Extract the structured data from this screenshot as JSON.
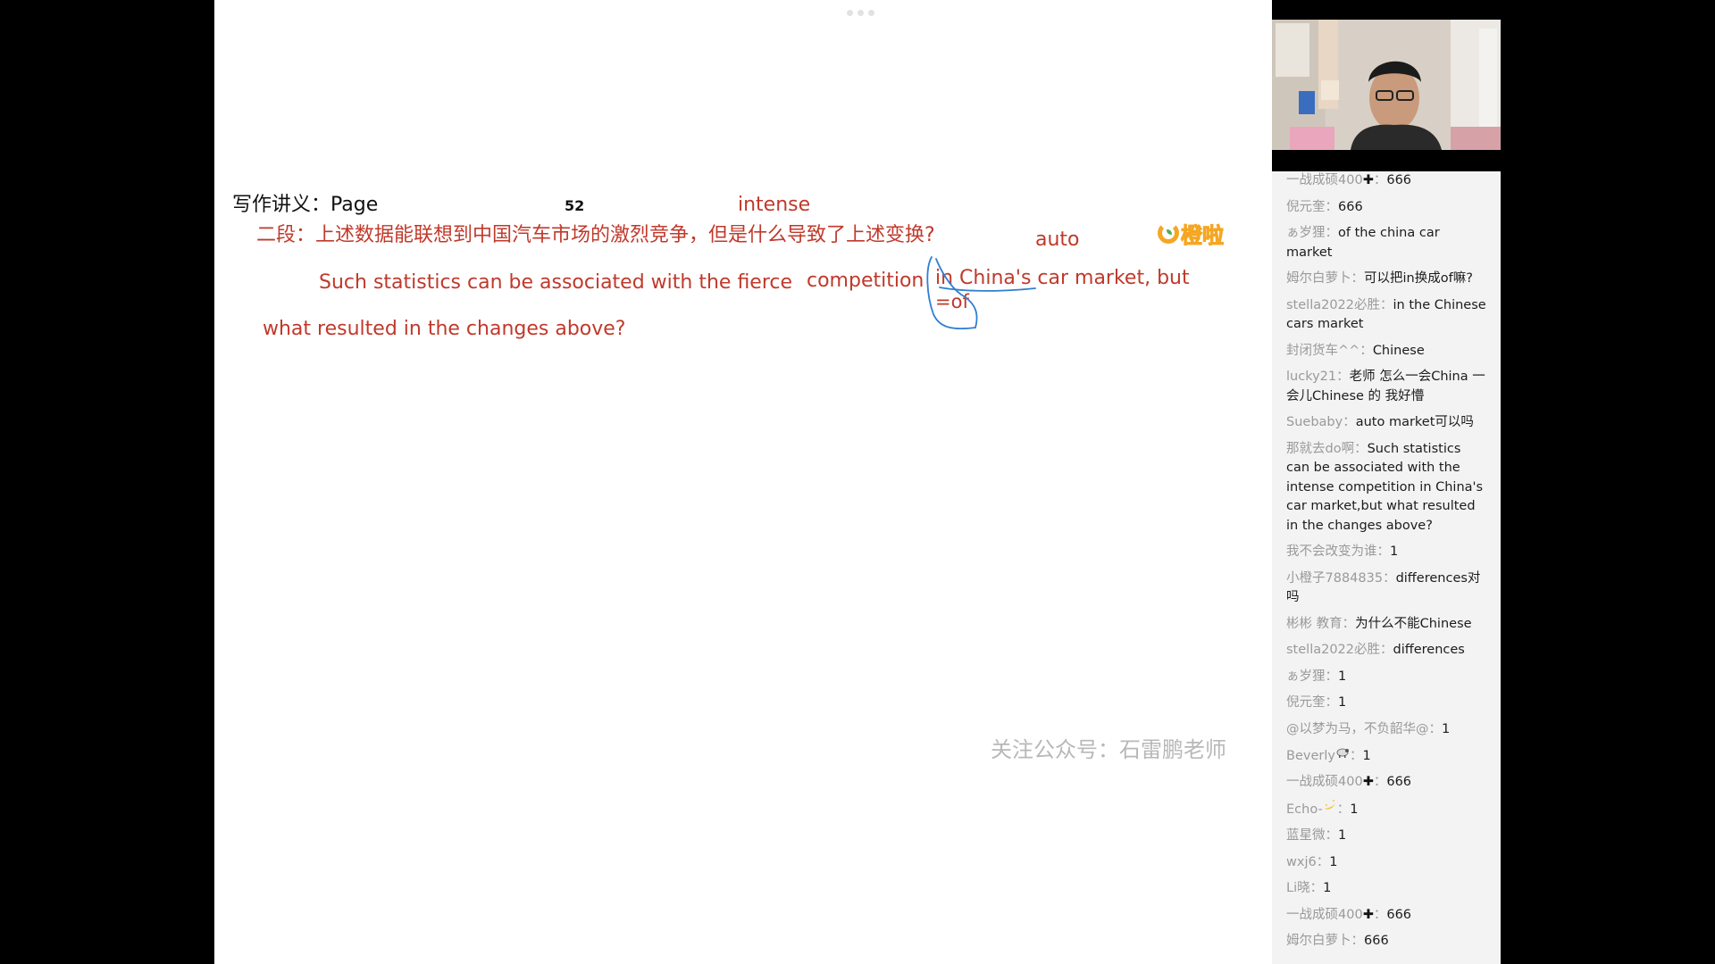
{
  "board": {
    "heading": "写作讲义：Page",
    "page_number": "52",
    "line1": "二段：上述数据能联想到中国汽车市场的激烈竞争，但是什么导致了上述变换?",
    "ann_intense": "intense",
    "ann_auto": "auto",
    "line2_a": "Such statistics can be associated with the fierce",
    "line2_b": "competition",
    "line2_c": "in China's car market, but",
    "ann_of": "=of",
    "line3": "what resulted in the changes above?",
    "logo_text": "橙啦",
    "watermark": "关注公众号：石雷鹏老师"
  },
  "chat": [
    {
      "user": "一战成硕400",
      "cross": true,
      "text": "666"
    },
    {
      "user": "倪元奎",
      "text": "666"
    },
    {
      "user": "ぁ岁狸",
      "text": "of the china car market"
    },
    {
      "user": "姆尔白萝卜",
      "text": "可以把in换成of嘛?"
    },
    {
      "user": "stella2022必胜",
      "text": "in the Chinese cars market"
    },
    {
      "user": "封闭货车^^",
      "text": "Chinese"
    },
    {
      "user": "lucky21",
      "text": "老师 怎么一会China 一会儿Chinese 的  我好懵"
    },
    {
      "user": "Suebaby",
      "text": "auto market可以吗"
    },
    {
      "user": "那就去do啊",
      "text": "Such statistics can be associated with the intense competition in China's car market,but what resulted in the changes above?"
    },
    {
      "user": "我不会改变为谁",
      "text": "1"
    },
    {
      "user": "小橙子7884835",
      "text": "differences对吗"
    },
    {
      "user": "彬彬 教育",
      "text": "为什么不能Chinese"
    },
    {
      "user": "stella2022必胜",
      "text": "differences"
    },
    {
      "user": "ぁ岁狸",
      "text": "1"
    },
    {
      "user": "倪元奎",
      "text": "1"
    },
    {
      "user": "@以梦为马，不负韶华@",
      "text": "1"
    },
    {
      "user": "Beverly",
      "emoji": "sheep",
      "text": "1"
    },
    {
      "user": "一战成硕400",
      "cross": true,
      "text": "666"
    },
    {
      "user": "Echo-",
      "emoji": "moon",
      "text": "1"
    },
    {
      "user": "蓝星微",
      "text": "1"
    },
    {
      "user": "wxj6",
      "text": "1"
    },
    {
      "user": "Li晓",
      "text": "1"
    },
    {
      "user": "一战成硕400",
      "cross": true,
      "text": "666"
    },
    {
      "user": "姆尔白萝卜",
      "text": "666"
    }
  ],
  "colors": {
    "handwriting": "#c0392b",
    "annotation_blue": "#2f7fd1",
    "chat_user": "#9a9a9a"
  }
}
